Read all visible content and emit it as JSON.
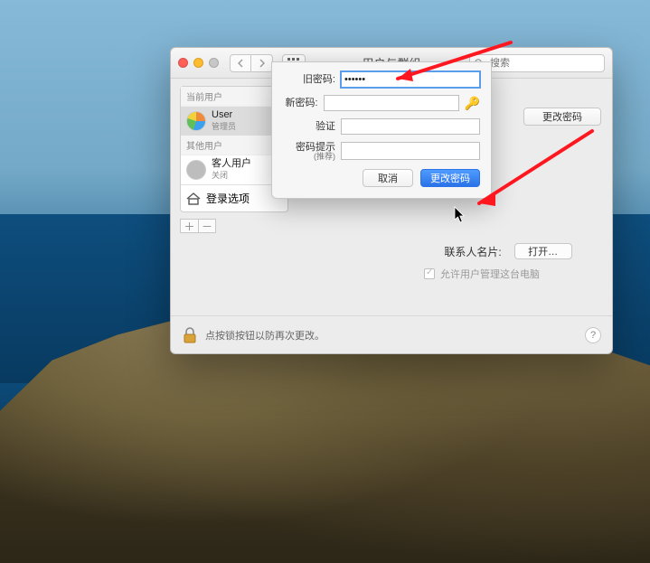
{
  "window": {
    "title": "用户与群组",
    "search_placeholder": "搜索"
  },
  "sidebar": {
    "current_label": "当前用户",
    "other_label": "其他用户",
    "items": [
      {
        "name": "User",
        "role": "管理员"
      },
      {
        "name": "客人用户",
        "role": "关闭"
      }
    ],
    "login_options_label": "登录选项"
  },
  "content": {
    "change_password_btn": "更改密码",
    "contact_label": "联系人名片:",
    "open_btn": "打开…",
    "allow_admin_label": "允许用户管理这台电脑"
  },
  "sheet": {
    "old_pw_label": "旧密码:",
    "old_pw_value": "••••••",
    "new_pw_label": "新密码:",
    "verify_label": "验证",
    "hint_label": "密码提示",
    "hint_sub": "(推荐)",
    "cancel": "取消",
    "confirm": "更改密码"
  },
  "footer": {
    "lock_text": "点按锁按钮以防再次更改。"
  }
}
